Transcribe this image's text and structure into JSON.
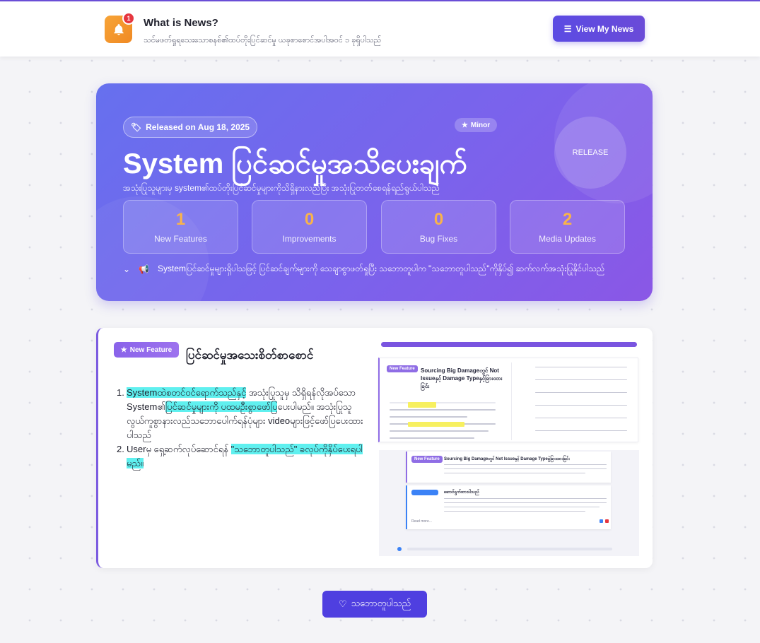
{
  "header": {
    "title": "What is News?",
    "subtitle": "သင်မဖတ်ရှုရသေးသောစနစ်၏ထပ်တိုးပြင်ဆင်မှု ယခုစာစောင်အပါအဝင် ၁ ခုရှိပါသည်",
    "badge_count": "1",
    "view_button": "View My News"
  },
  "hero": {
    "released": "Released on Aug 18, 2025",
    "minor": "Minor",
    "release_label": "RELEASE",
    "title": "System ပြင်ဆင်မှုအသိပေးချက်",
    "subtitle": "အသုံးပြုသူများမှ system၏ထပ်တိုးပြင်ဆင်မှုများကိုသိရှိနားလည်ပြီး အသုံးပြုတတ်စေရန်ရည်ရွယ်ပါသည်",
    "stats": [
      {
        "value": "1",
        "label": "New Features"
      },
      {
        "value": "0",
        "label": "Improvements"
      },
      {
        "value": "0",
        "label": "Bug Fixes"
      },
      {
        "value": "2",
        "label": "Media Updates"
      }
    ],
    "note": "Systemပြင်ဆင်မှုများရှိပါသဖြင့် ပြင်ဆင်ချက်များကို သေချာစွာဖတ်ရှုပြီး သဘောတူပါက \"သဘောတူပါသည်\"ကိုနှိပ်၍ ဆက်လက်အသုံးပြုနိုင်ပါသည်"
  },
  "card": {
    "badge": "New Feature",
    "title": "ပြင်ဆင်မှုအသေးစိတ်စာစောင်",
    "steps": [
      {
        "num": "1.",
        "highlight": "Systemထဲစတင်ဝင်ရောက်သည်နှင့်",
        "text1": " အသုံးပြုသူမှ သိရှိရန်လိုအပ်သော System၏",
        "highlight2": "ပြင်ဆင်မှုများကို ပထမဦးစွာဖော်ပြ",
        "text2": "ပေးပါမည်။ အသုံးပြုသူလွယ်ကူစွာနားလည်သဘောပေါက်ရန်ပုံများ videoများဖြင့်ဖော်ပြပေးထားပါသည်"
      },
      {
        "num": "2.",
        "text1": "Userမှ ရှေ့ဆက်လုပ်ဆောင်ရန် ",
        "highlight": "\"သဘောတူပါသည်\" ခလုပ်ကိုနှိပ်ပေးရပါမည်။"
      }
    ],
    "screenshot": {
      "panel_badge": "New Feature",
      "panel_title": "Sourcing Big Damageတွင် Not Issueနှင့် Damage Typeနှင့်ခြားထားခြင်း",
      "panel2_title": "Sourcing Big Damageတွင် Not Issueနှင့် Damage Typeခွဲခြားထားခြင်း",
      "panel3_title": "ဆောင်ရွက်ထားပါသည်",
      "read_more": "Read more..."
    }
  },
  "footer": {
    "agree_button": "သဘောတူပါသည်"
  }
}
